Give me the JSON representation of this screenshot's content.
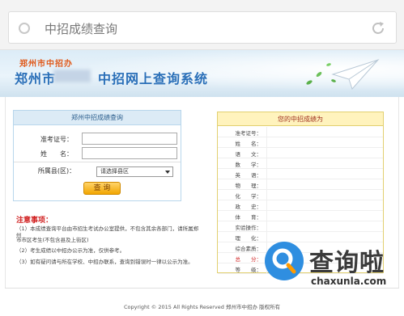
{
  "search": {
    "text": "中招成绩查询"
  },
  "banner": {
    "subtitle": "郑州市中招办",
    "title_prefix": "郑州市",
    "title_suffix": "中招网上查询系统"
  },
  "query_form": {
    "title": "郑州中招成绩查询",
    "exam_id_label": "准考证号：",
    "name_label": "姓　　名：",
    "school_label": "所属县(区)：",
    "school_selected": "请选择县区",
    "submit_label": "查 询"
  },
  "notes": {
    "title": "注意事项：",
    "items": [
      "（1）本成绩查询平台由市招生考试办公室提供，不包含其余各部门，请所属郑州",
      "市市区考生(不包含县及上街区)",
      "（2）考生成绩以中招办公示为准，仅供参考。",
      "（3）如有疑问请与所在学校、中招办联系，查询到错误时一律以公示为准。"
    ]
  },
  "results": {
    "title": "您的中招成绩为",
    "fields": [
      "准考证号：",
      "姓　　名：",
      "语　　文：",
      "数　　学：",
      "英　　语：",
      "物　　理：",
      "化　　学：",
      "政　　史：",
      "体　　育：",
      "实验操作：",
      "理　　化：",
      "综合素质：",
      "总　　分：",
      "等　　级："
    ]
  },
  "watermark": {
    "brand": "查询啦",
    "url": "chaxunla.com"
  },
  "footer": {
    "text": "Copyright © 2015 All Rights Reserved 郑州市中招办 版权所有"
  }
}
